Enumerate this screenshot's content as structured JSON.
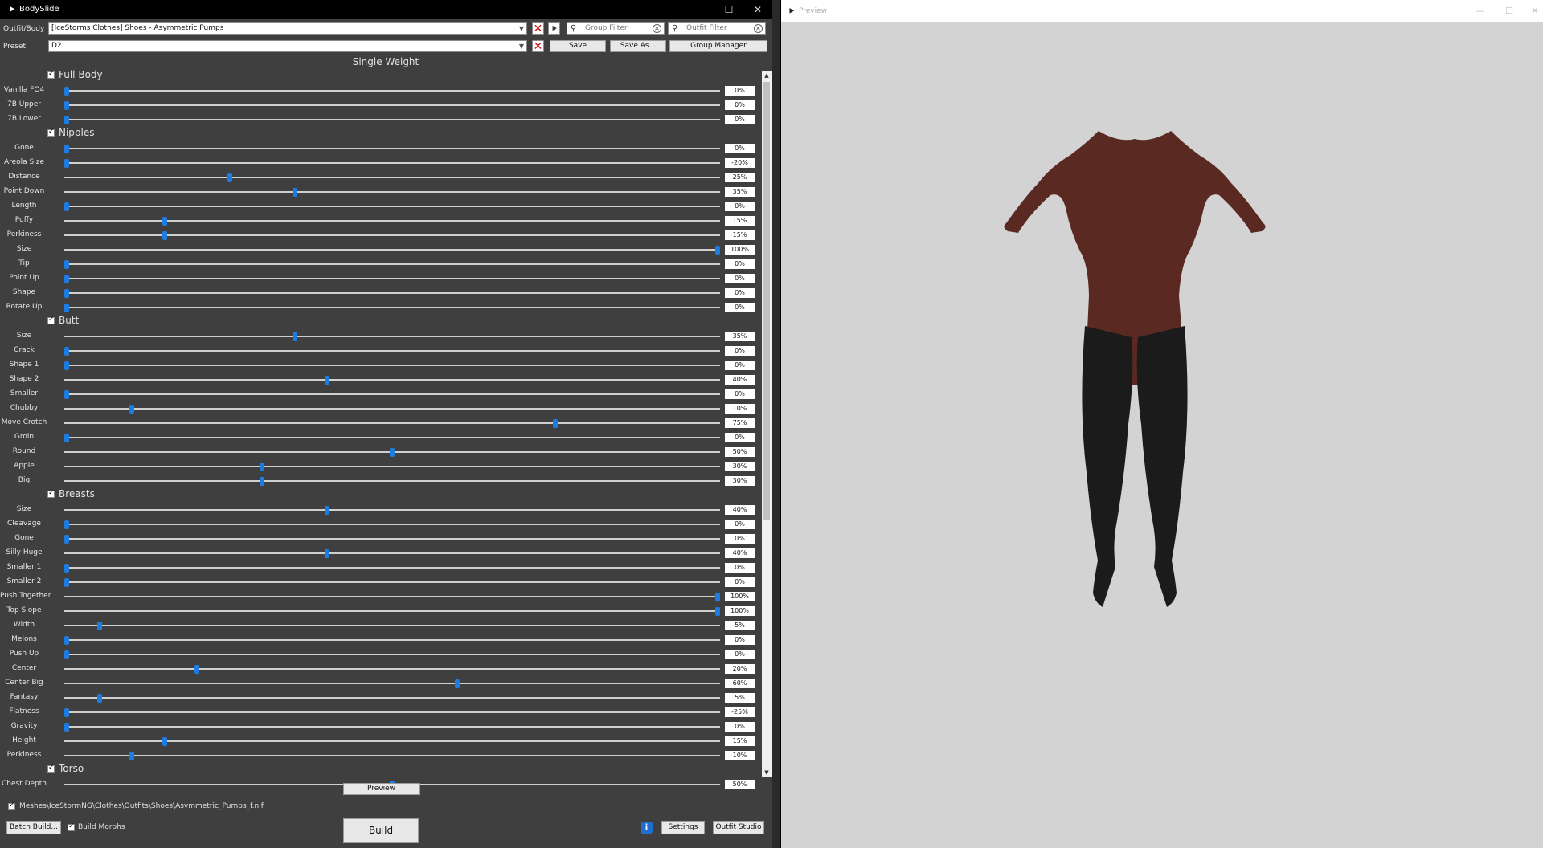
{
  "window": {
    "title": "BodySlide",
    "minimize": "—",
    "maximize": "☐",
    "close": "✕"
  },
  "outfit": {
    "label": "Outfit/Body",
    "value": "[IceStorms Clothes] Shoes - Asymmetric Pumps"
  },
  "preset": {
    "label": "Preset",
    "value": "D2"
  },
  "filters": {
    "group_placeholder": "Group Filter",
    "outfit_placeholder": "Outfit Filter"
  },
  "buttons": {
    "save": "Save",
    "save_as": "Save As...",
    "group_manager": "Group Manager",
    "preview": "Preview",
    "build": "Build",
    "batch_build": "Batch Build...",
    "settings": "Settings",
    "outfit_studio": "Outfit Studio"
  },
  "weight_title": "Single Weight",
  "groups": [
    {
      "name": "Full Body",
      "sliders": [
        {
          "label": "Vanilla FO4",
          "value": 0
        },
        {
          "label": "7B Upper",
          "value": 0
        },
        {
          "label": "7B Lower",
          "value": 0
        }
      ]
    },
    {
      "name": "Nipples",
      "sliders": [
        {
          "label": "Gone",
          "value": 0
        },
        {
          "label": "Areola Size",
          "value": -20
        },
        {
          "label": "Distance",
          "value": 25
        },
        {
          "label": "Point Down",
          "value": 35
        },
        {
          "label": "Length",
          "value": 0
        },
        {
          "label": "Puffy",
          "value": 15
        },
        {
          "label": "Perkiness",
          "value": 15
        },
        {
          "label": "Size",
          "value": 100
        },
        {
          "label": "Tip",
          "value": 0
        },
        {
          "label": "Point Up",
          "value": 0
        },
        {
          "label": "Shape",
          "value": 0
        },
        {
          "label": "Rotate Up",
          "value": 0
        }
      ]
    },
    {
      "name": "Butt",
      "sliders": [
        {
          "label": "Size",
          "value": 35
        },
        {
          "label": "Crack",
          "value": 0
        },
        {
          "label": "Shape 1",
          "value": 0
        },
        {
          "label": "Shape 2",
          "value": 40
        },
        {
          "label": "Smaller",
          "value": 0
        },
        {
          "label": "Chubby",
          "value": 10
        },
        {
          "label": "Move Crotch",
          "value": 75
        },
        {
          "label": "Groin",
          "value": 0
        },
        {
          "label": "Round",
          "value": 50
        },
        {
          "label": "Apple",
          "value": 30
        },
        {
          "label": "Big",
          "value": 30
        }
      ]
    },
    {
      "name": "Breasts",
      "sliders": [
        {
          "label": "Size",
          "value": 40
        },
        {
          "label": "Cleavage",
          "value": 0
        },
        {
          "label": "Gone",
          "value": 0
        },
        {
          "label": "Silly Huge",
          "value": 40
        },
        {
          "label": "Smaller 1",
          "value": 0
        },
        {
          "label": "Smaller 2",
          "value": 0
        },
        {
          "label": "Push Together",
          "value": 100
        },
        {
          "label": "Top Slope",
          "value": 100
        },
        {
          "label": "Width",
          "value": 5
        },
        {
          "label": "Melons",
          "value": 0
        },
        {
          "label": "Push Up",
          "value": 0
        },
        {
          "label": "Center",
          "value": 20
        },
        {
          "label": "Center Big",
          "value": 60
        },
        {
          "label": "Fantasy",
          "value": 5
        },
        {
          "label": "Flatness",
          "value": -25
        },
        {
          "label": "Gravity",
          "value": 0
        },
        {
          "label": "Height",
          "value": 15
        },
        {
          "label": "Perkiness",
          "value": 10
        }
      ]
    },
    {
      "name": "Torso",
      "sliders": [
        {
          "label": "Chest Depth",
          "value": 50
        }
      ]
    }
  ],
  "output_path": "Meshes\\IceStormNG\\Clothes\\Outfits\\Shoes\\Asymmetric_Pumps_f.nif",
  "build_morphs": "Build Morphs",
  "preview_window": {
    "title": "Preview",
    "minimize": "—",
    "maximize": "☐",
    "close": "✕"
  },
  "colors": {
    "panel": "#3f3f3f",
    "slider_thumb": "#1e7be0",
    "preview_bg": "#d3d3d3",
    "skin": "#5a2a22",
    "boots": "#1b1b1b"
  }
}
